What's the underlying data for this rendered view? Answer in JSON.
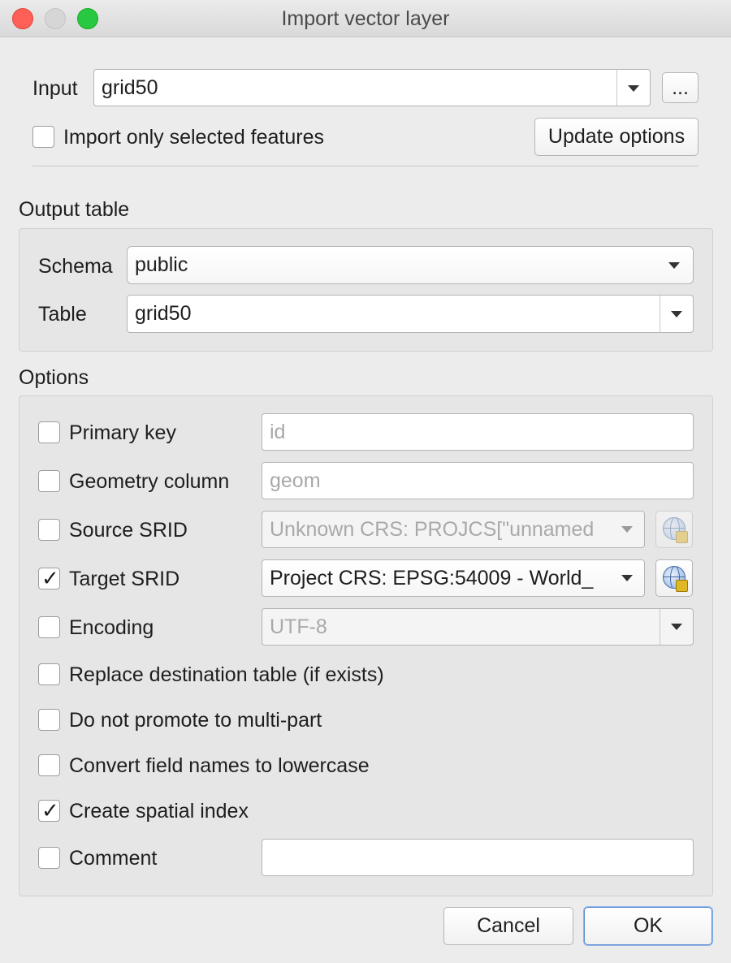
{
  "window": {
    "title": "Import vector layer"
  },
  "input": {
    "label": "Input",
    "value": "grid50",
    "browse_label": "..."
  },
  "import_selected": {
    "label": "Import only selected features",
    "checked": false
  },
  "update_options": {
    "label": "Update options"
  },
  "output_table": {
    "title": "Output table",
    "schema_label": "Schema",
    "schema_value": "public",
    "table_label": "Table",
    "table_value": "grid50"
  },
  "options": {
    "title": "Options",
    "primary_key": {
      "label": "Primary key",
      "placeholder": "id",
      "checked": false
    },
    "geometry_column": {
      "label": "Geometry column",
      "placeholder": "geom",
      "checked": false
    },
    "source_srid": {
      "label": "Source SRID",
      "value": "Unknown CRS: PROJCS[\"unnamed",
      "checked": false
    },
    "target_srid": {
      "label": "Target SRID",
      "value": "Project CRS: EPSG:54009 - World_",
      "checked": true
    },
    "encoding": {
      "label": "Encoding",
      "value": "UTF-8",
      "checked": false
    },
    "replace_table": {
      "label": "Replace destination table (if exists)",
      "checked": false
    },
    "no_multipart": {
      "label": "Do not promote to multi-part",
      "checked": false
    },
    "lowercase": {
      "label": "Convert field names to lowercase",
      "checked": false
    },
    "spatial_index": {
      "label": "Create spatial index",
      "checked": true
    },
    "comment": {
      "label": "Comment",
      "value": "",
      "checked": false
    }
  },
  "buttons": {
    "cancel": "Cancel",
    "ok": "OK"
  },
  "check_glyph": "✓"
}
